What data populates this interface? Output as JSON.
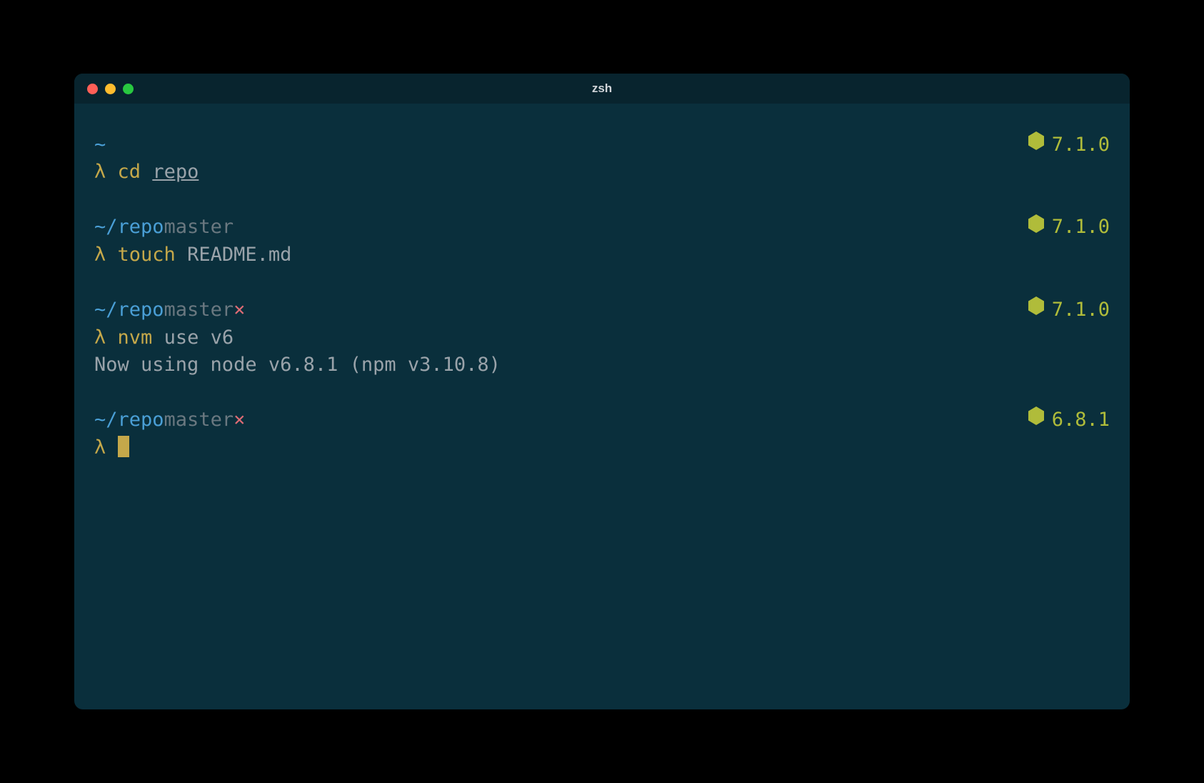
{
  "window": {
    "title": "zsh"
  },
  "colors": {
    "bg": "#0a2f3c",
    "titlebar": "#08242e",
    "red": "#ff5f57",
    "yellow": "#febc2e",
    "green": "#28c840",
    "path": "#4a9fd6",
    "lambda": "#c5a84a",
    "version": "#b0bc3a",
    "dirty": "#e06c75"
  },
  "blocks": [
    {
      "path": "~",
      "branch": "",
      "dirty": false,
      "node_version": "7.1.0",
      "lambda": "λ",
      "cmd_parts": [
        {
          "text": "cd",
          "style": "cmd-yellow"
        },
        {
          "text": " ",
          "style": ""
        },
        {
          "text": "repo",
          "style": "cmd-gray underline"
        }
      ],
      "output": ""
    },
    {
      "path": "~/repo",
      "branch": "master",
      "dirty": false,
      "node_version": "7.1.0",
      "lambda": "λ",
      "cmd_parts": [
        {
          "text": "touch",
          "style": "cmd-yellow"
        },
        {
          "text": " README.md",
          "style": "cmd-gray"
        }
      ],
      "output": ""
    },
    {
      "path": "~/repo",
      "branch": "master",
      "dirty": true,
      "dirty_mark": "×",
      "node_version": "7.1.0",
      "lambda": "λ",
      "cmd_parts": [
        {
          "text": "nvm",
          "style": "cmd-yellow"
        },
        {
          "text": " use v6",
          "style": "cmd-gray"
        }
      ],
      "output": "Now using node v6.8.1 (npm v3.10.8)"
    },
    {
      "path": "~/repo",
      "branch": "master",
      "dirty": true,
      "dirty_mark": "×",
      "node_version": "6.8.1",
      "lambda": "λ",
      "cmd_parts": [],
      "output": "",
      "cursor": true
    }
  ]
}
